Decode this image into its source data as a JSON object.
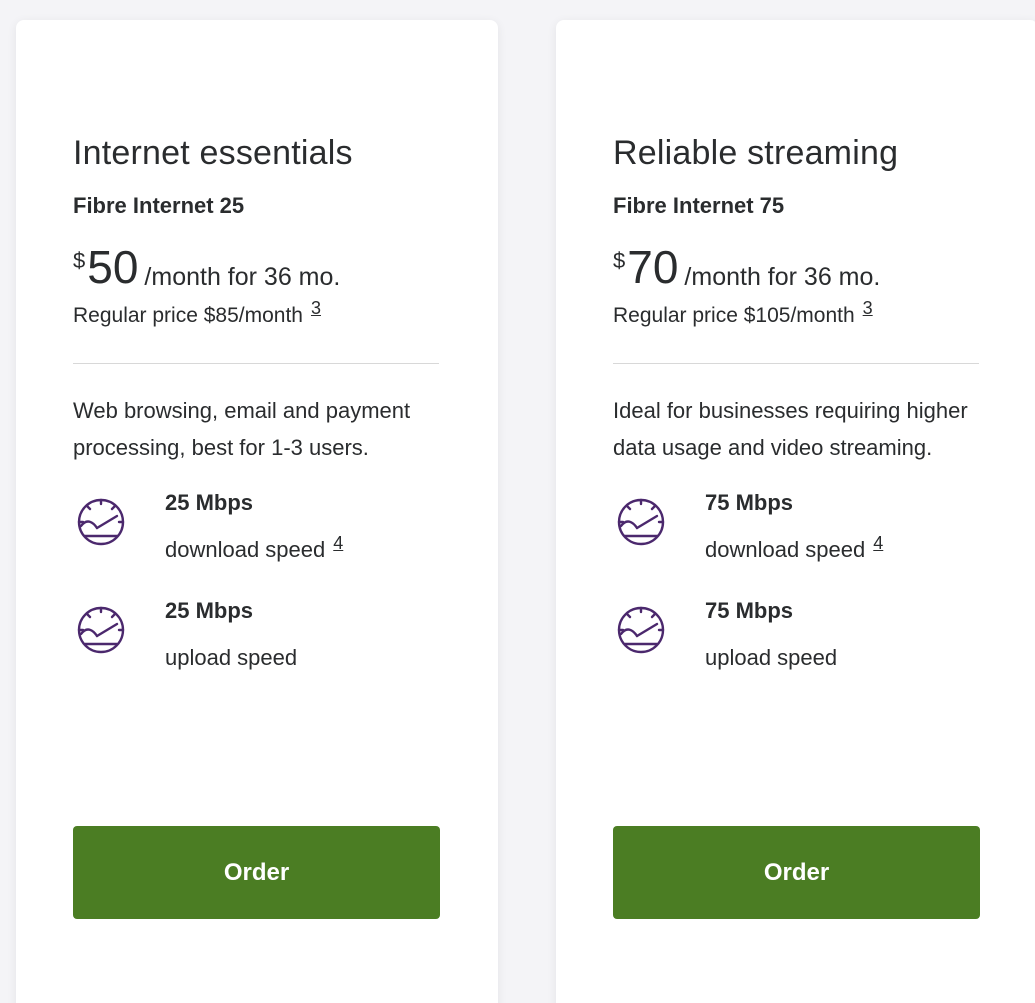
{
  "plans": [
    {
      "title": "Internet essentials",
      "product": "Fibre Internet 25",
      "currency": "$",
      "price": "50",
      "per": "/month for 36 mo.",
      "regular": "Regular price $85/month",
      "regular_footnote": "3",
      "description": "Web browsing, email and payment processing, best for 1-3 users.",
      "download_value": "25 Mbps",
      "download_label": "download speed",
      "download_footnote": "4",
      "upload_value": "25 Mbps",
      "upload_label": "upload speed",
      "order_label": "Order"
    },
    {
      "title": "Reliable streaming",
      "product": "Fibre Internet 75",
      "currency": "$",
      "price": "70",
      "per": "/month for 36 mo.",
      "regular": "Regular price $105/month",
      "regular_footnote": "3",
      "description": "Ideal for businesses requiring higher data usage and video streaming.",
      "download_value": "75 Mbps",
      "download_label": "download speed",
      "download_footnote": "4",
      "upload_value": "75 Mbps",
      "upload_label": "upload speed",
      "order_label": "Order"
    }
  ],
  "icons": {
    "speed": "speedometer-icon"
  },
  "colors": {
    "accent_green": "#4b7d23",
    "icon_purple": "#4b286d",
    "text": "#2a2c2e",
    "divider": "#d8d8d8"
  }
}
